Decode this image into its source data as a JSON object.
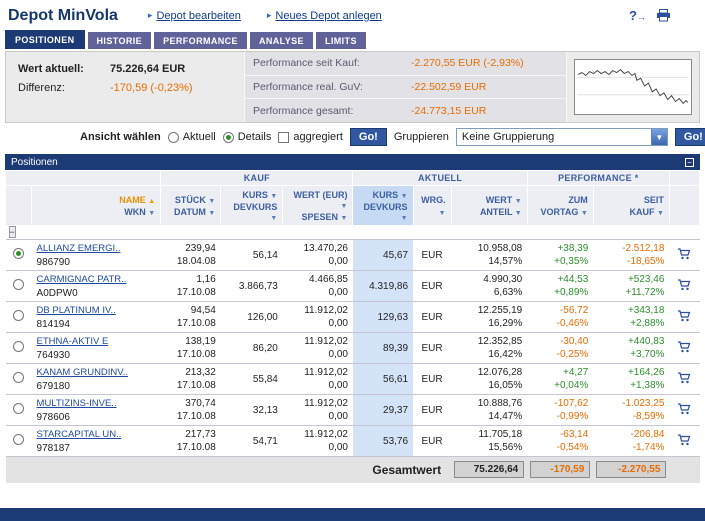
{
  "header": {
    "title": "Depot MinVola",
    "link_edit": "Depot bearbeiten",
    "link_new": "Neues Depot anlegen"
  },
  "tabs": [
    {
      "label": "POSITIONEN",
      "active": true
    },
    {
      "label": "HISTORIE",
      "active": false
    },
    {
      "label": "PERFORMANCE",
      "active": false
    },
    {
      "label": "ANALYSE",
      "active": false
    },
    {
      "label": "LIMITS",
      "active": false
    }
  ],
  "summary": {
    "wert_label": "Wert aktuell:",
    "wert_value": "75.226,64 EUR",
    "diff_label": "Differenz:",
    "diff_value": "-170,59 (-0,23%)"
  },
  "performance": {
    "rows": [
      {
        "label": "Performance seit Kauf:",
        "value": "-2.270,55 EUR (-2,93%)"
      },
      {
        "label": "Performance real. GuV:",
        "value": "-22.502,59 EUR"
      },
      {
        "label": "Performance gesamt:",
        "value": "-24.773,15 EUR"
      }
    ]
  },
  "controls": {
    "view_label": "Ansicht wählen",
    "option_aktuell": "Aktuell",
    "option_details": "Details",
    "option_aggregiert": "aggregiert",
    "go_label": "Go!",
    "group_label": "Gruppieren",
    "group_value": "Keine Gruppierung"
  },
  "positions": {
    "panel_title": "Positionen",
    "groups": {
      "kauf": "KAUF",
      "aktuell": "AKTUELL",
      "performance": "PERFORMANCE *"
    },
    "columns": {
      "name": "NAME",
      "wkn": "WKN",
      "stueck": "STÜCK",
      "datum": "DATUM",
      "kurs_kauf": "KURS",
      "devkurs_kauf": "DEVKURS",
      "wert_eur": "WERT (EUR)",
      "spesen": "SPESEN",
      "kurs_akt": "KURS",
      "devkurs_akt": "DEVKURS",
      "wrg": "WRG.",
      "wert": "WERT",
      "anteil": "ANTEIL",
      "zum": "ZUM",
      "vortag": "VORTAG",
      "seit": "SEIT",
      "kauf": "KAUF"
    },
    "rows": [
      {
        "name": "ALLIANZ EMERGI..",
        "wkn": "986790",
        "selected": true,
        "stueck": "239,94",
        "datum": "18.04.08",
        "kurs": "56,14",
        "wert_kauf": "13.470,26",
        "spesen": "0,00",
        "kurs_akt": "45,67",
        "wrg": "EUR",
        "wert": "10.958,08",
        "anteil": "14,57%",
        "vortag_abs": "+38,39",
        "vortag_pct": "+0,35%",
        "kauf_abs": "-2.512,18",
        "kauf_pct": "-18,65%"
      },
      {
        "name": "CARMIGNAC PATR..",
        "wkn": "A0DPW0",
        "selected": false,
        "stueck": "1,16",
        "datum": "17.10.08",
        "kurs": "3.866,73",
        "wert_kauf": "4.466,85",
        "spesen": "0,00",
        "kurs_akt": "4.319,86",
        "wrg": "EUR",
        "wert": "4.990,30",
        "anteil": "6,63%",
        "vortag_abs": "+44,53",
        "vortag_pct": "+0,89%",
        "kauf_abs": "+523,46",
        "kauf_pct": "+11,72%"
      },
      {
        "name": "DB PLATINUM IV..",
        "wkn": "814194",
        "selected": false,
        "stueck": "94,54",
        "datum": "17.10.08",
        "kurs": "126,00",
        "wert_kauf": "11.912,02",
        "spesen": "0,00",
        "kurs_akt": "129,63",
        "wrg": "EUR",
        "wert": "12.255,19",
        "anteil": "16,29%",
        "vortag_abs": "-56,72",
        "vortag_pct": "-0,46%",
        "kauf_abs": "+343,18",
        "kauf_pct": "+2,88%"
      },
      {
        "name": "ETHNA-AKTIV E",
        "wkn": "764930",
        "selected": false,
        "stueck": "138,19",
        "datum": "17.10.08",
        "kurs": "86,20",
        "wert_kauf": "11.912,02",
        "spesen": "0,00",
        "kurs_akt": "89,39",
        "wrg": "EUR",
        "wert": "12.352,85",
        "anteil": "16,42%",
        "vortag_abs": "-30,40",
        "vortag_pct": "-0,25%",
        "kauf_abs": "+440,83",
        "kauf_pct": "+3,70%"
      },
      {
        "name": "KANAM GRUNDINV..",
        "wkn": "679180",
        "selected": false,
        "stueck": "213,32",
        "datum": "17.10.08",
        "kurs": "55,84",
        "wert_kauf": "11.912,02",
        "spesen": "0,00",
        "kurs_akt": "56,61",
        "wrg": "EUR",
        "wert": "12.076,28",
        "anteil": "16,05%",
        "vortag_abs": "+4,27",
        "vortag_pct": "+0,04%",
        "kauf_abs": "+164,26",
        "kauf_pct": "+1,38%"
      },
      {
        "name": "MULTIZINS-INVE..",
        "wkn": "978606",
        "selected": false,
        "stueck": "370,74",
        "datum": "17.10.08",
        "kurs": "32,13",
        "wert_kauf": "11.912,02",
        "spesen": "0,00",
        "kurs_akt": "29,37",
        "wrg": "EUR",
        "wert": "10.888,76",
        "anteil": "14,47%",
        "vortag_abs": "-107,62",
        "vortag_pct": "-0,99%",
        "kauf_abs": "-1.023,25",
        "kauf_pct": "-8,59%"
      },
      {
        "name": "STARCAPITAL UN..",
        "wkn": "978187",
        "selected": false,
        "stueck": "217,73",
        "datum": "17.10.08",
        "kurs": "54,71",
        "wert_kauf": "11.912,02",
        "spesen": "0,00",
        "kurs_akt": "53,76",
        "wrg": "EUR",
        "wert": "11.705,18",
        "anteil": "15,56%",
        "vortag_abs": "-63,14",
        "vortag_pct": "-0,54%",
        "kauf_abs": "-206,84",
        "kauf_pct": "-1,74%"
      }
    ],
    "footer": {
      "label": "Gesamtwert",
      "wert": "75.226,64",
      "vortag": "-170,59",
      "kauf": "-2.270,55"
    }
  },
  "icons": {
    "link_arrow": "▸",
    "help": "?",
    "help_arrow": "→",
    "sort_asc": "▲",
    "sort_desc": "▼",
    "dropdown_arrow": "▼",
    "minimize": "−",
    "collapse": "−"
  },
  "colors": {
    "positive": "#2e8f2e",
    "negative": "#e86c00",
    "accent_navy": "#1c3a74"
  }
}
